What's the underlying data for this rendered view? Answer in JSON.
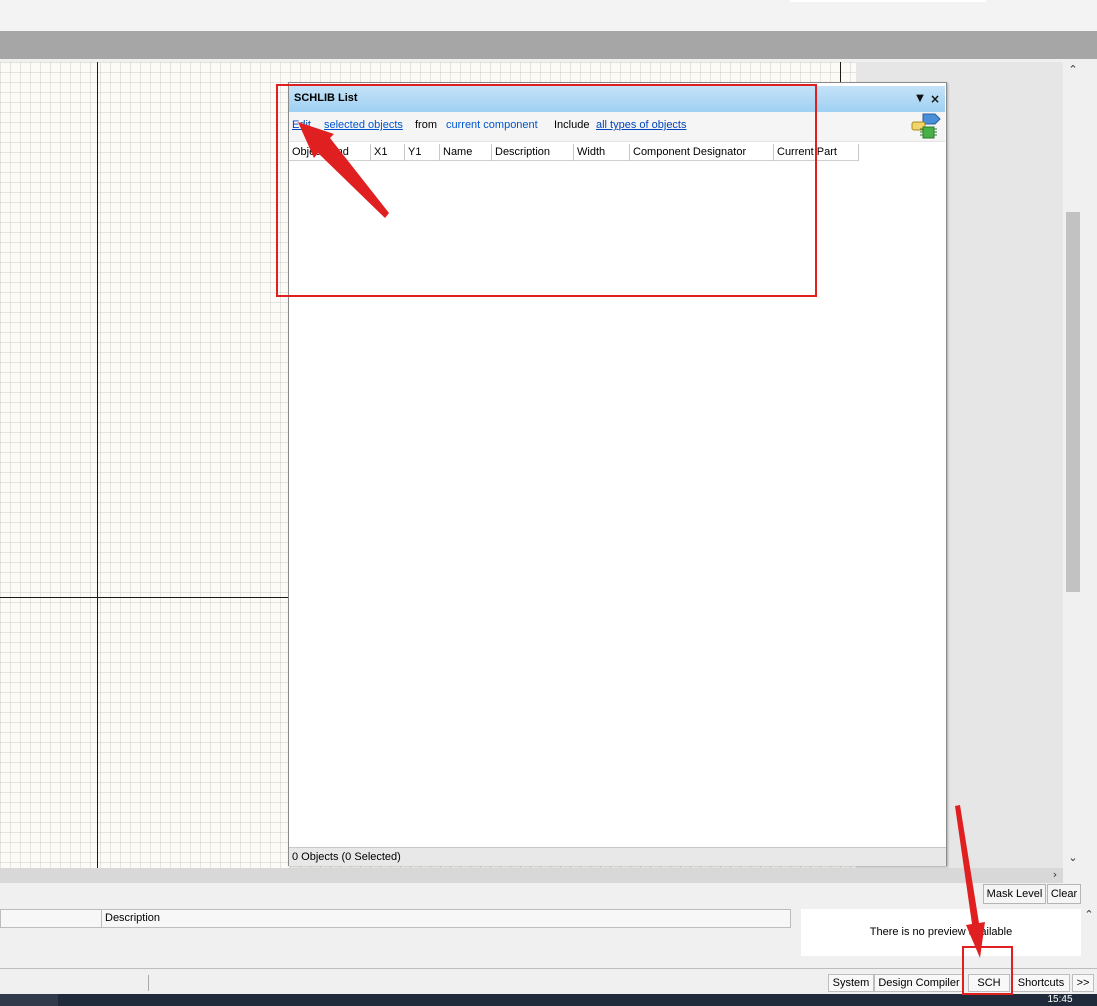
{
  "panel": {
    "title": "SCHLIB List",
    "toolbar": {
      "edit": "Edit",
      "selected_objects": "selected objects",
      "from": "from",
      "current_component": "current component",
      "include": "Include",
      "all_types": "all types of objects"
    },
    "columns": [
      "Object Kind",
      "X1",
      "Y1",
      "Name",
      "Description",
      "Width",
      "Component Designator",
      "Current Part"
    ],
    "status": "0 Objects (0 Selected)"
  },
  "buttons": {
    "mask_level": "Mask Level",
    "clear": "Clear"
  },
  "bottom": {
    "description_header": "Description",
    "preview_text": "There is no preview available"
  },
  "status_bar": {
    "system": "System",
    "design_compiler": "Design Compiler",
    "sch": "SCH",
    "shortcuts": "Shortcuts",
    "more": ">>"
  },
  "taskbar": {
    "clock": "15:45"
  },
  "colors": {
    "highlight": "#e02020",
    "link": "#0044bb",
    "title_bar": "#9fd0f2"
  },
  "icons": [
    "menu-triangle-icon",
    "close-icon",
    "filter-icon",
    "arrow-up-icon",
    "arrow-down-icon",
    "arrow-right-icon"
  ]
}
